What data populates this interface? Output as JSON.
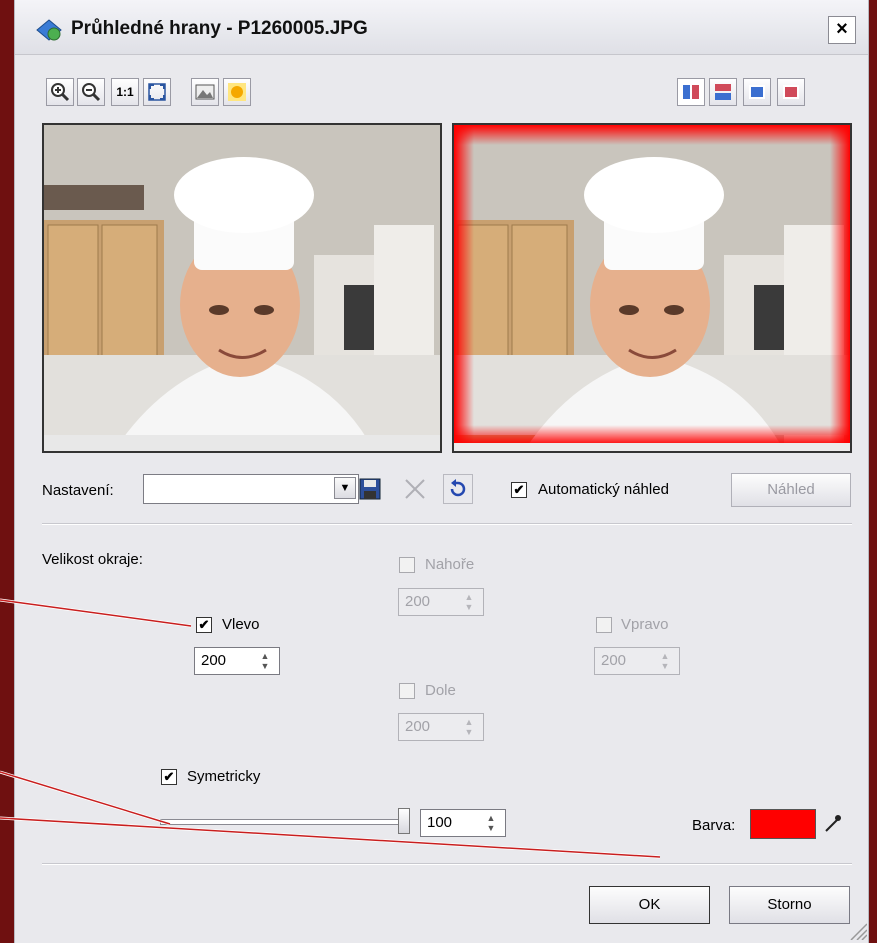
{
  "window": {
    "title": "Průhledné hrany - P1260005.JPG",
    "close_label": "×"
  },
  "toolbar": {
    "zoom_in_icon": "zoom-in-icon",
    "zoom_out_icon": "zoom-out-icon",
    "actual_size_label": "1:1",
    "fit_icon": "fit-window-icon",
    "view_icons": [
      "split-vertical-icon",
      "split-horizontal-icon",
      "single-before-icon",
      "single-after-icon"
    ]
  },
  "settings": {
    "label": "Nastavení:",
    "value": "",
    "auto_preview_label": "Automatický náhled",
    "auto_preview_checked": true,
    "preview_button": "Náhled"
  },
  "edges": {
    "label": "Velikost okraje:",
    "top": {
      "label": "Nahoře",
      "value": "200",
      "checked": false,
      "enabled": false
    },
    "left": {
      "label": "Vlevo",
      "value": "200",
      "checked": true,
      "enabled": true
    },
    "right": {
      "label": "Vpravo",
      "value": "200",
      "checked": false,
      "enabled": false
    },
    "bottom": {
      "label": "Dole",
      "value": "200",
      "checked": false,
      "enabled": false
    },
    "symmetric_label": "Symetricky",
    "symmetric_checked": true
  },
  "opacity": {
    "value": "100",
    "slider_fraction": 1.0
  },
  "color": {
    "label": "Barva:",
    "value": "#ff0000"
  },
  "buttons": {
    "ok": "OK",
    "cancel": "Storno"
  },
  "colors": {
    "dialog_bg": "#e9e9ed",
    "annotation_line": "#c81e1e",
    "edge_color": "#ff0000"
  }
}
